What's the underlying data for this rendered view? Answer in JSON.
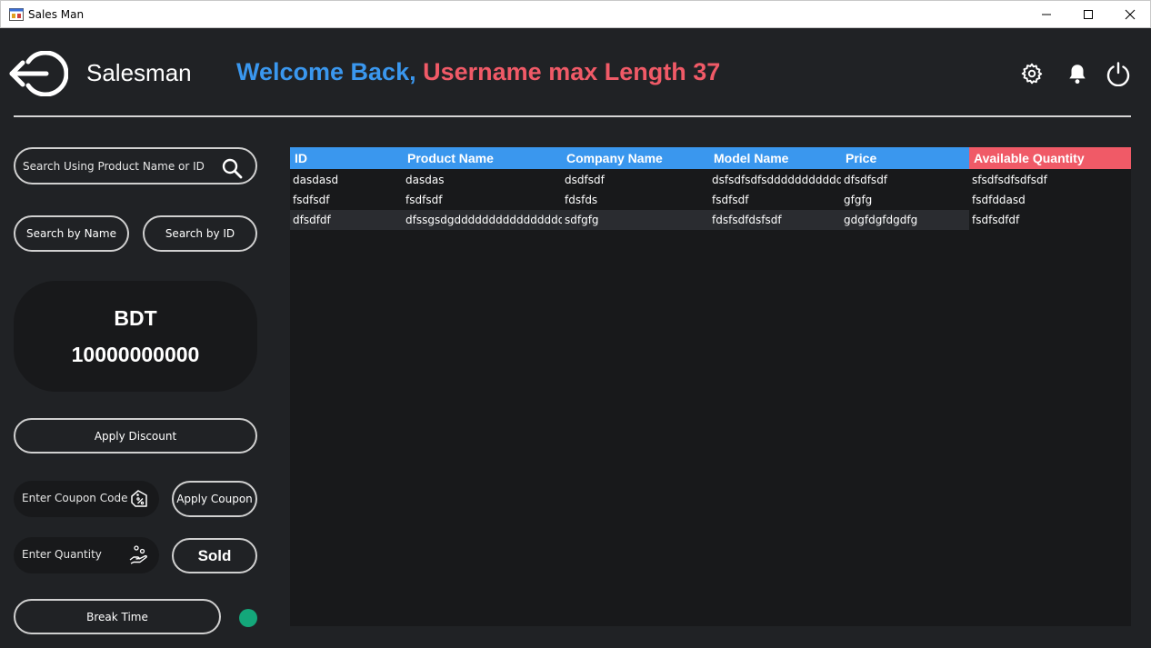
{
  "window": {
    "title": "Sales Man"
  },
  "header": {
    "app_name": "Salesman",
    "welcome_prefix": "Welcome Back,",
    "username": "Username max Length 37"
  },
  "search": {
    "placeholder": "Search Using Product Name or ID",
    "by_name_label": "Search by Name",
    "by_id_label": "Search by ID"
  },
  "balance": {
    "currency": "BDT",
    "amount": "10000000000"
  },
  "actions": {
    "apply_discount": "Apply Discount",
    "coupon_placeholder": "Enter Coupon Code",
    "apply_coupon": "Apply Coupon",
    "quantity_placeholder": "Enter Quantity",
    "sold": "Sold",
    "break_time": "Break Time"
  },
  "colors": {
    "accent_blue": "#3a97ee",
    "accent_red": "#f05a67",
    "status_green": "#14a77a"
  },
  "table": {
    "columns": [
      "ID",
      "Product Name",
      "Company Name",
      "Model Name",
      "Price",
      "Available Quantity"
    ],
    "rows": [
      [
        "dasdasd",
        "dasdas",
        "dsdfsdf",
        "dsfsdfsdfsdddddddddddddd",
        "dfsdfsdf",
        "sfsdfsdfsdfsdf"
      ],
      [
        "fsdfsdf",
        "fsdfsdf",
        "fdsfds",
        "fsdfsdf",
        "gfgfg",
        "fsdfddasd"
      ],
      [
        "dfsdfdf",
        "dfssgsdgdddddddddddddddddds",
        "sdfgfg",
        "fdsfsdfdsfsdf",
        "gdgfdgfdgdfg",
        "fsdfsdfdf"
      ]
    ]
  }
}
